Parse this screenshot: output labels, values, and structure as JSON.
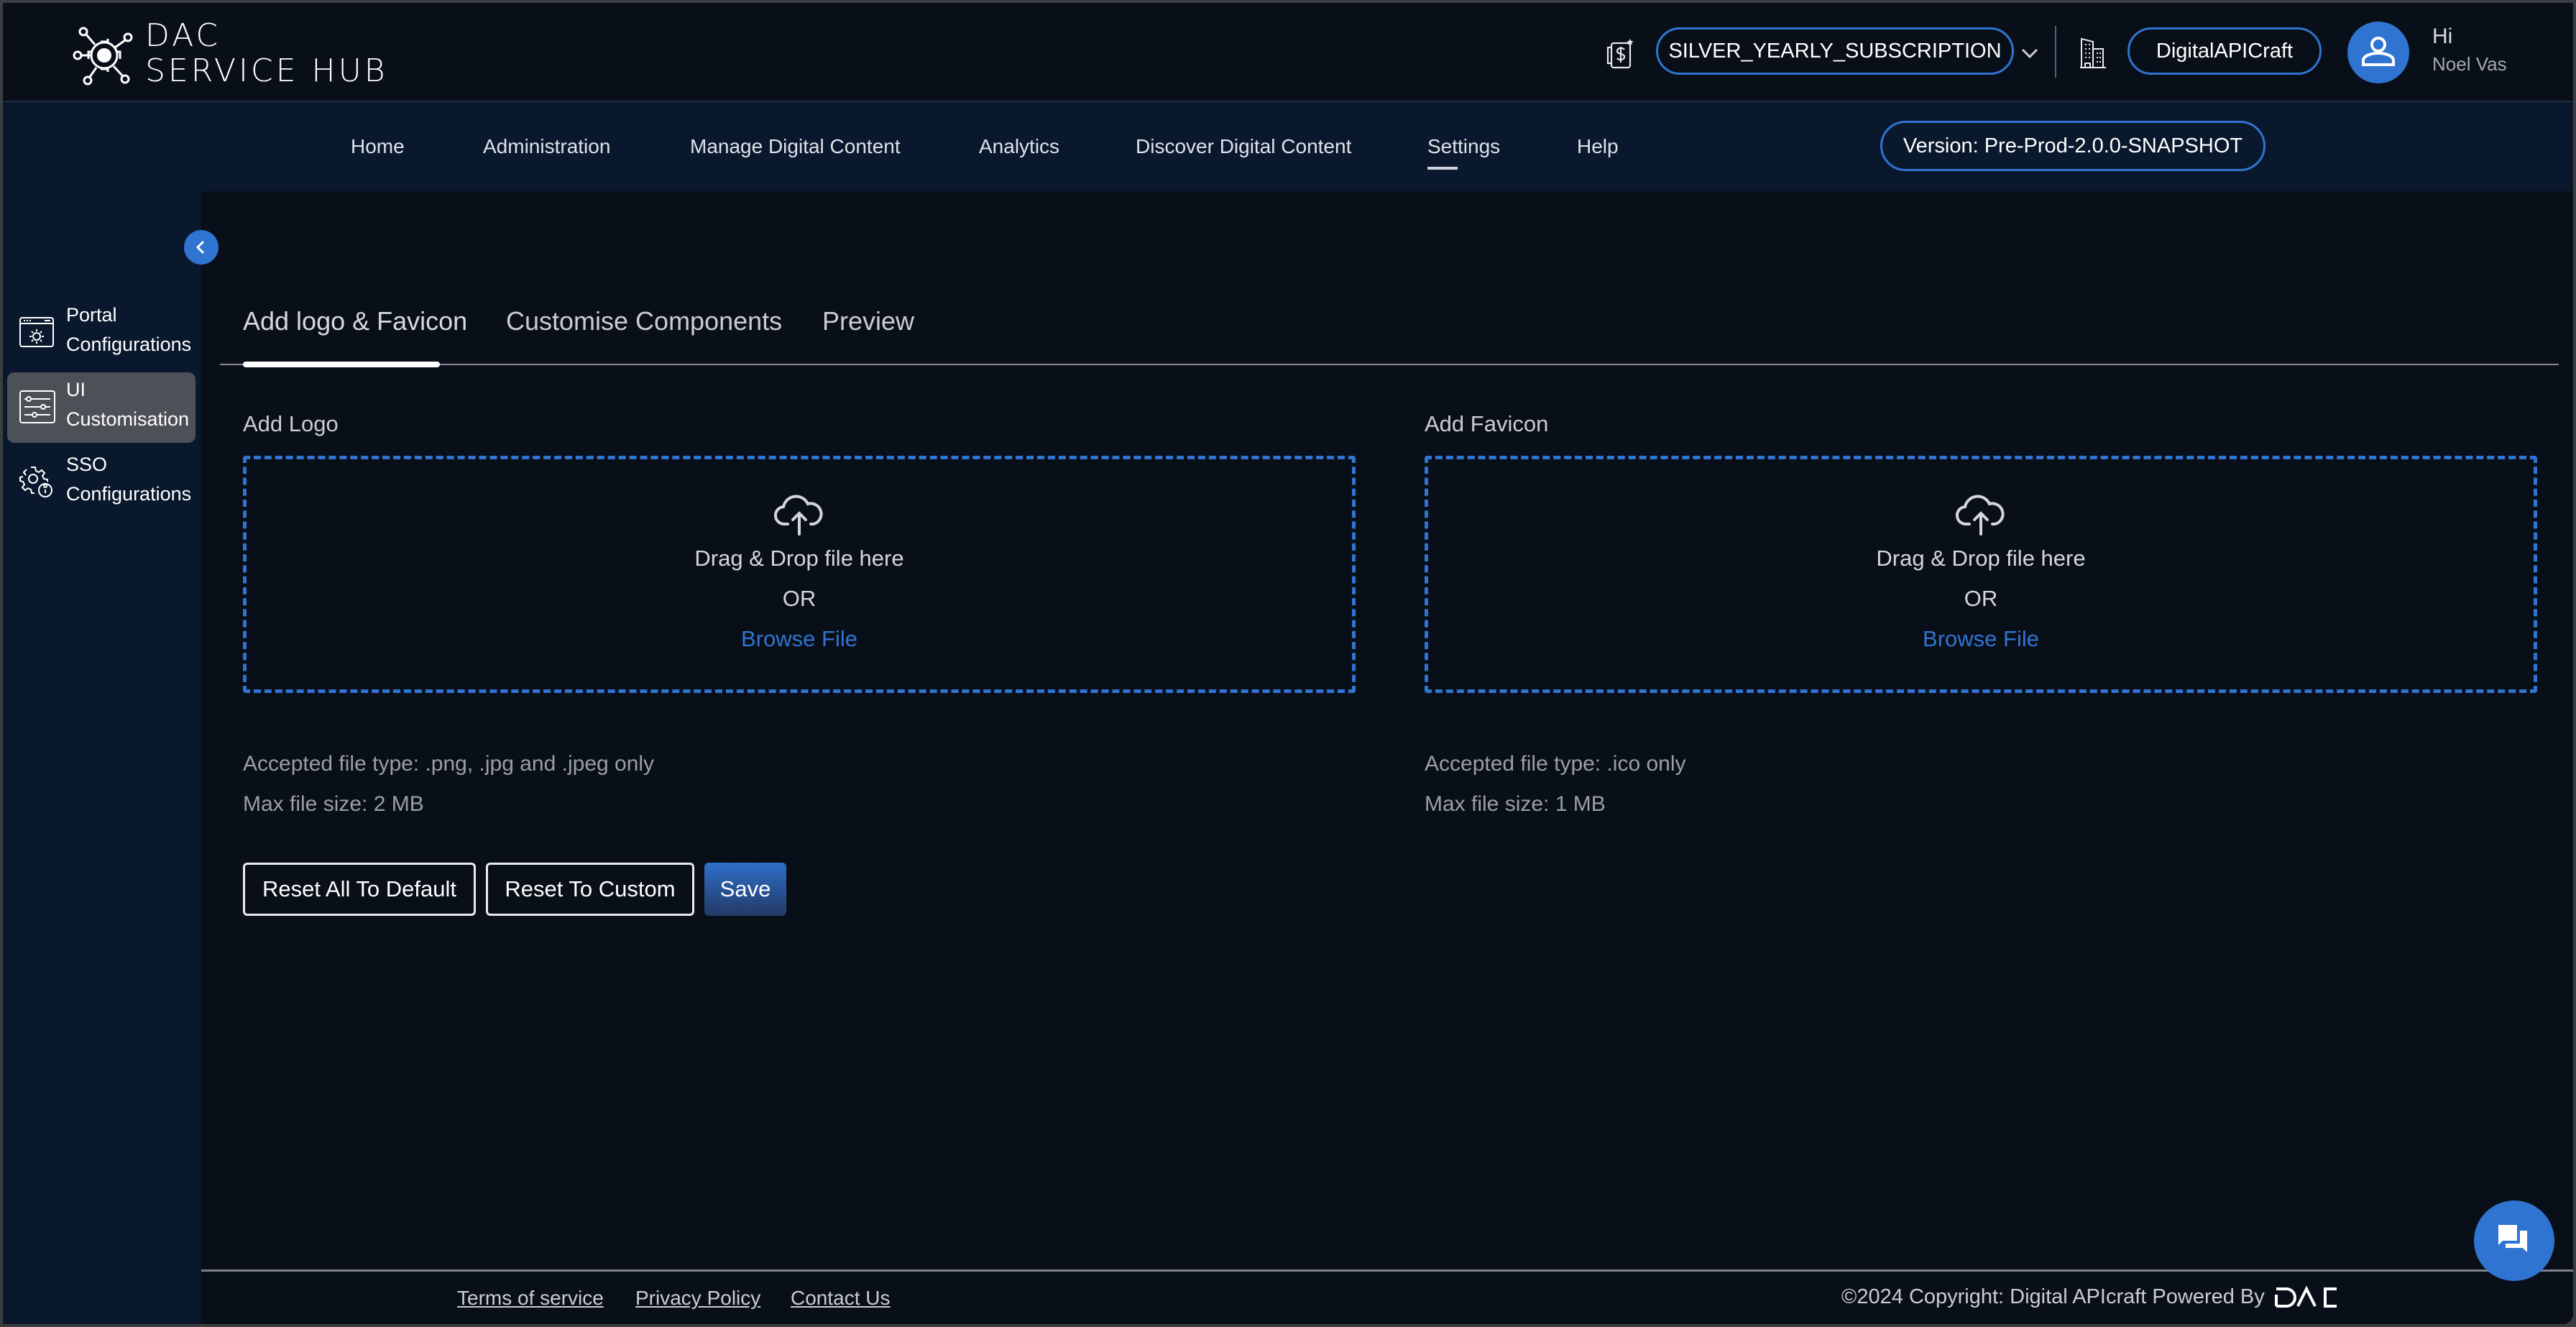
{
  "header": {
    "logo_line1": "DAC",
    "logo_line2": "SERVICE HUB",
    "subscription": "SILVER_YEARLY_SUBSCRIPTION",
    "organization": "DigitalAPICraft",
    "greeting": "Hi",
    "user_name": "Noel Vas",
    "icons": {
      "subscription": "subscription-dollar-icon",
      "organization": "building-icon",
      "avatar": "user-icon",
      "dropdown": "chevron-down-icon"
    }
  },
  "nav": {
    "items": [
      {
        "label": "Home",
        "active": false
      },
      {
        "label": "Administration",
        "active": false
      },
      {
        "label": "Manage Digital Content",
        "active": false
      },
      {
        "label": "Analytics",
        "active": false
      },
      {
        "label": "Discover Digital Content",
        "active": false
      },
      {
        "label": "Settings",
        "active": true
      },
      {
        "label": "Help",
        "active": false
      }
    ],
    "version": "Version: Pre-Prod-2.0.0-SNAPSHOT"
  },
  "sidebar": {
    "items": [
      {
        "line1": "Portal",
        "line2": "Configurations",
        "icon": "portal-settings-icon",
        "active": false
      },
      {
        "line1": "UI",
        "line2": "Customisation",
        "icon": "sliders-icon",
        "active": true
      },
      {
        "line1": "SSO",
        "line2": "Configurations",
        "icon": "gear-lock-icon",
        "active": false
      }
    ]
  },
  "tabs": [
    {
      "label": "Add logo & Favicon",
      "active": true
    },
    {
      "label": "Customise Components",
      "active": false
    },
    {
      "label": "Preview",
      "active": false
    }
  ],
  "uploads": {
    "logo": {
      "title": "Add Logo",
      "drag_text": "Drag & Drop file here",
      "or_text": "OR",
      "browse_label": "Browse File",
      "accepted": "Accepted file type: .png, .jpg and .jpeg only",
      "max_size": "Max file size: 2 MB"
    },
    "favicon": {
      "title": "Add Favicon",
      "drag_text": "Drag & Drop file here",
      "or_text": "OR",
      "browse_label": "Browse File",
      "accepted": "Accepted file type: .ico only",
      "max_size": "Max file size: 1 MB"
    }
  },
  "actions": {
    "reset_default": "Reset All To Default",
    "reset_custom": "Reset To Custom",
    "save": "Save"
  },
  "footer": {
    "links": [
      "Terms of service",
      "Privacy Policy",
      "Contact Us"
    ],
    "copyright": "©2024 Copyright: Digital APIcraft Powered By",
    "powered_logo": "DAC"
  },
  "colors": {
    "accent": "#2f74d0",
    "background": "#090f19",
    "nav_background": "#0a182d",
    "active_sidebar": "#4e5058"
  }
}
